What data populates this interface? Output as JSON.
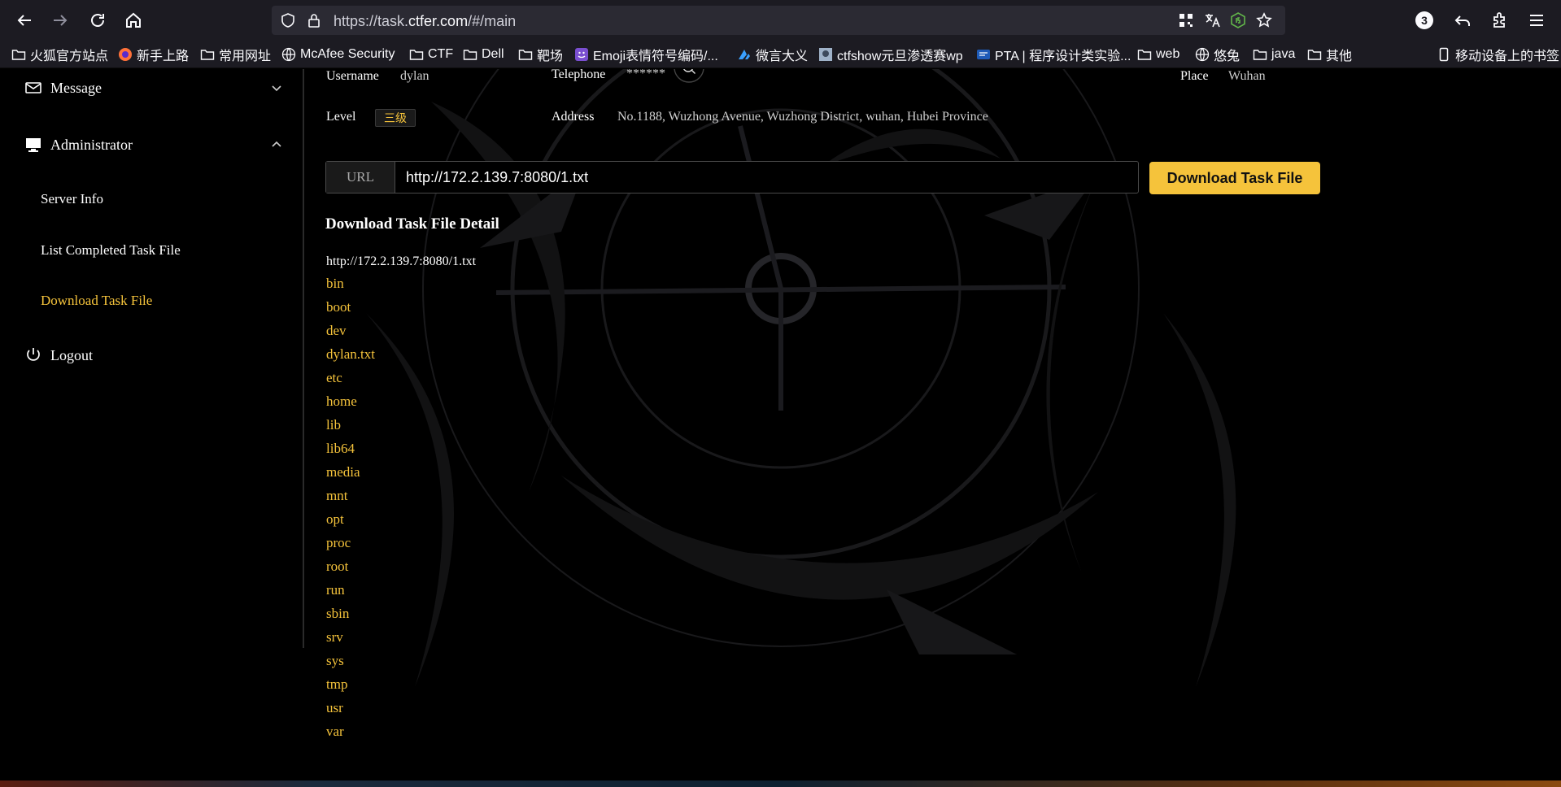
{
  "browser": {
    "url_prefix": "https://task.",
    "url_domain": "ctfer.com",
    "url_path": "/#/main",
    "tab_count": "3",
    "bookmarks": [
      {
        "label": "火狐官方站点",
        "icon": "folder-icon"
      },
      {
        "label": "新手上路",
        "icon": "firefox-icon"
      },
      {
        "label": "常用网址",
        "icon": "folder-icon"
      },
      {
        "label": "McAfee Security",
        "icon": "globe-icon"
      },
      {
        "label": "CTF",
        "icon": "folder-icon"
      },
      {
        "label": "Dell",
        "icon": "folder-icon"
      },
      {
        "label": "靶场",
        "icon": "folder-icon"
      },
      {
        "label": "Emoji表情符号编码/...",
        "icon": "emoji-icon"
      },
      {
        "label": "微言大义",
        "icon": "site-icon"
      },
      {
        "label": "ctfshow元旦渗透赛wp",
        "icon": "site-icon"
      },
      {
        "label": "PTA | 程序设计类实验...",
        "icon": "site-icon"
      },
      {
        "label": "web",
        "icon": "folder-icon"
      },
      {
        "label": "悠兔",
        "icon": "globe-icon"
      },
      {
        "label": "java",
        "icon": "folder-icon"
      },
      {
        "label": "其他",
        "icon": "folder-icon"
      }
    ],
    "mobile_bookmarks": "移动设备上的书签"
  },
  "sidebar": {
    "message": "Message",
    "administrator": "Administrator",
    "sub_items": [
      "Server Info",
      "List Completed Task File",
      "Download Task File"
    ],
    "logout": "Logout"
  },
  "profile": {
    "username_label": "Username",
    "username": "dylan",
    "telephone_label": "Telephone",
    "telephone": "******",
    "place_label": "Place",
    "place": "Wuhan",
    "level_label": "Level",
    "level": "三级",
    "address_label": "Address",
    "address": "No.1188, Wuzhong Avenue, Wuzhong District, wuhan, Hubei Province"
  },
  "download": {
    "prefix": "URL",
    "url_value": "http://172.2.139.7:8080/1.txt",
    "button": "Download Task File"
  },
  "detail": {
    "title": "Download Task File Detail",
    "url": "http://172.2.139.7:8080/1.txt",
    "files": [
      "bin",
      "boot",
      "dev",
      "dylan.txt",
      "etc",
      "home",
      "lib",
      "lib64",
      "media",
      "mnt",
      "opt",
      "proc",
      "root",
      "run",
      "sbin",
      "srv",
      "sys",
      "tmp",
      "usr",
      "var"
    ]
  },
  "colors": {
    "accent": "#f5c33b",
    "page_bg": "#000000",
    "chrome_bg": "#1c1b22"
  }
}
